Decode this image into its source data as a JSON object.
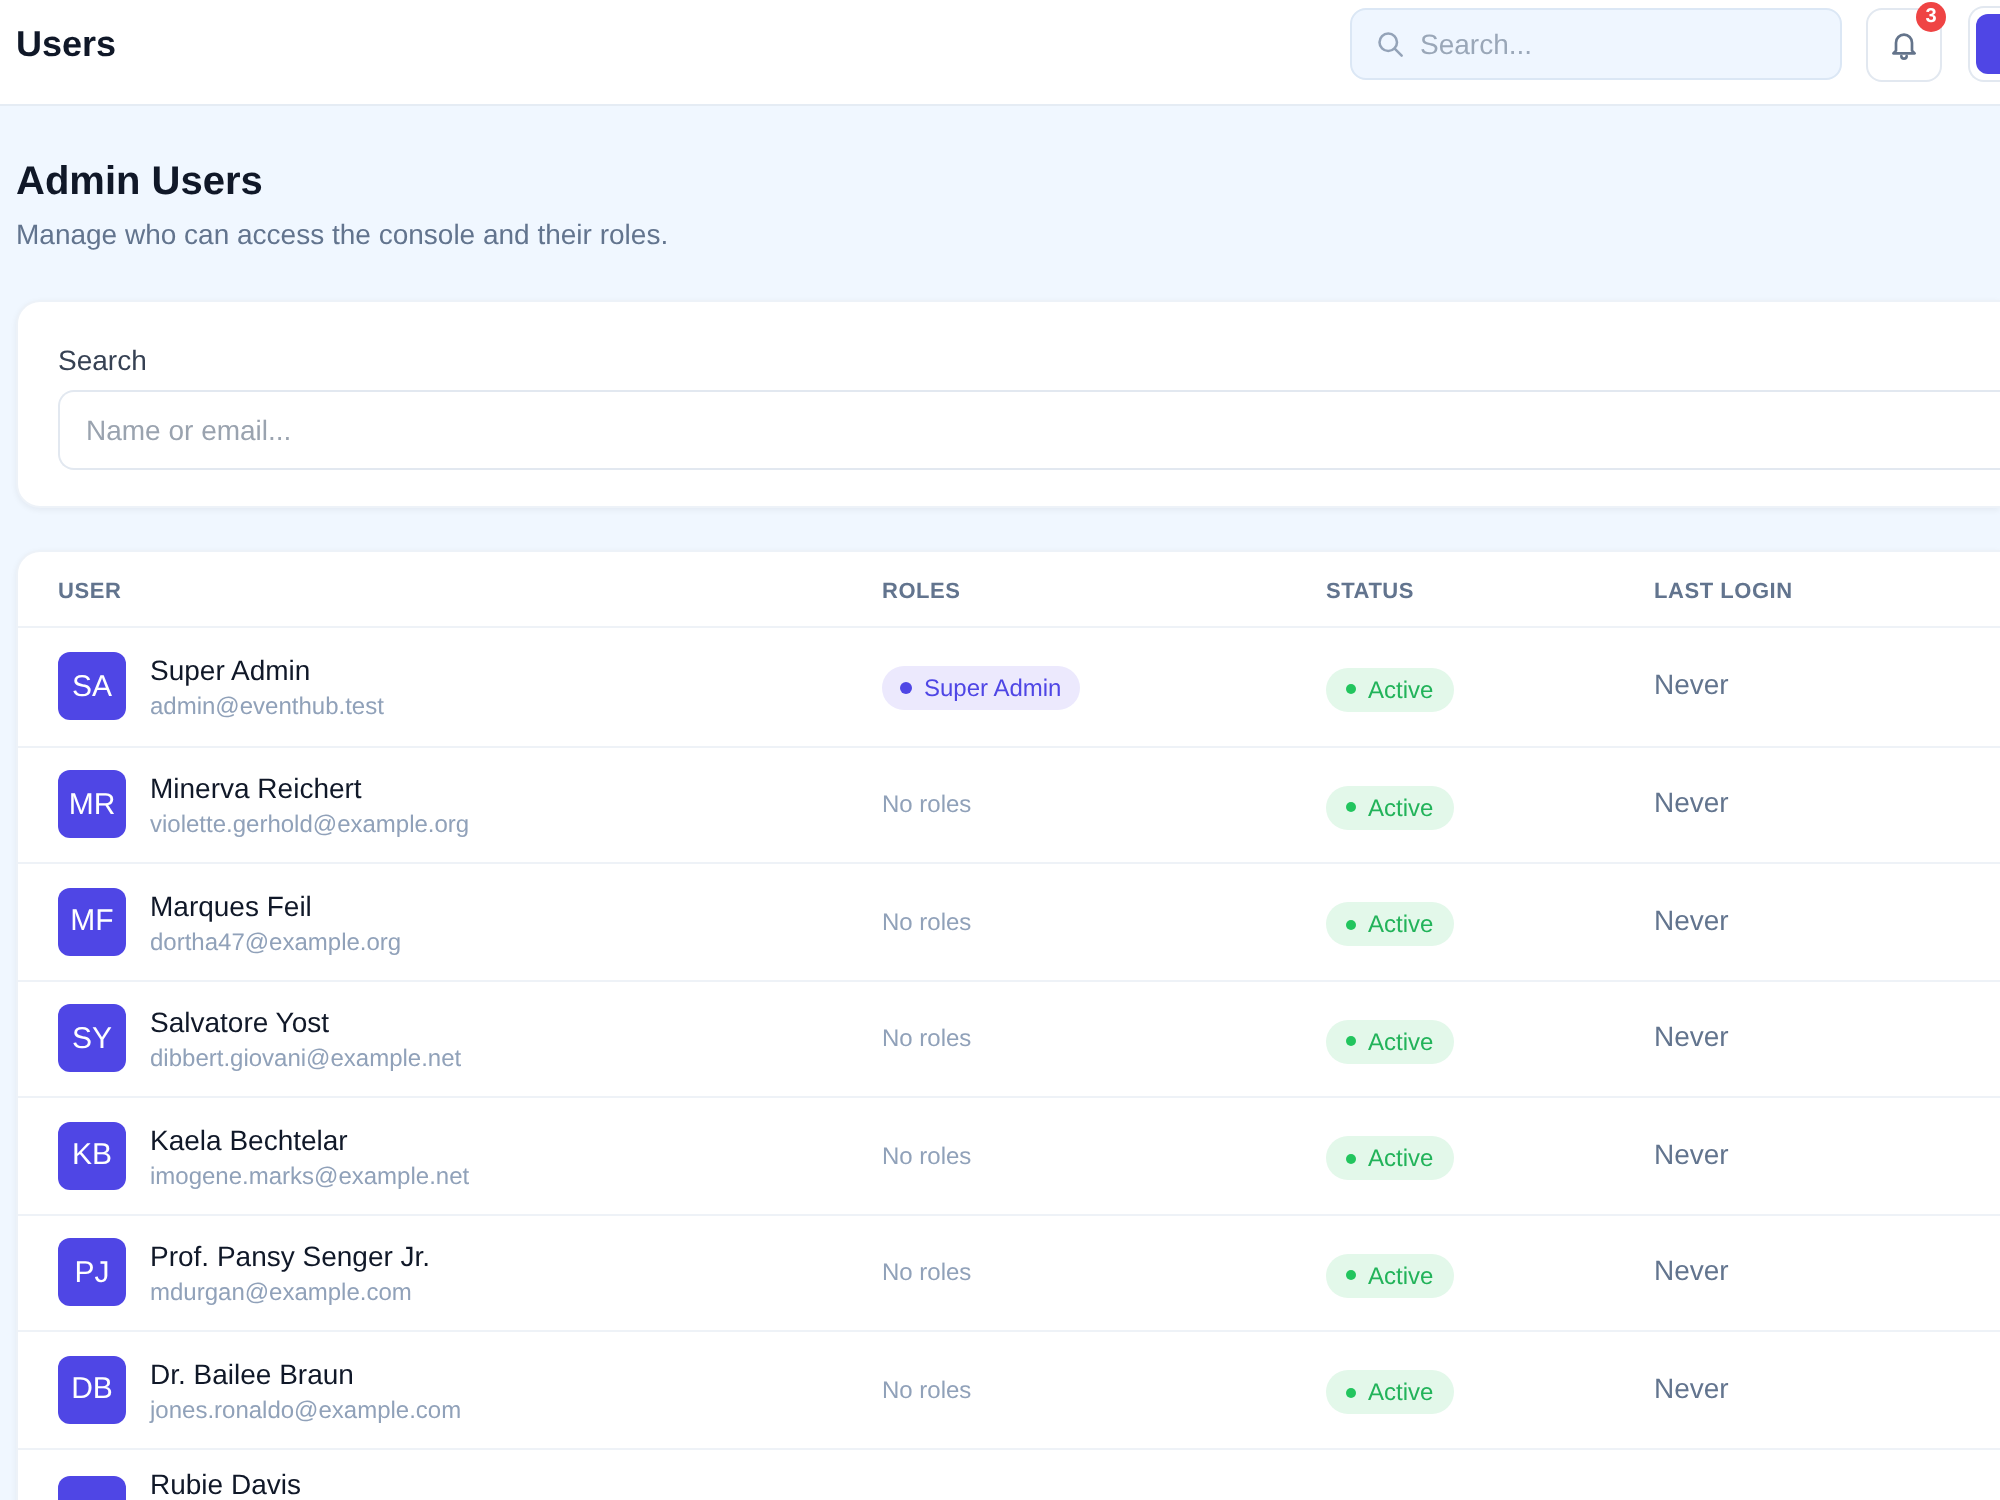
{
  "header": {
    "title": "Users",
    "search": {
      "placeholder": "Search..."
    },
    "notifications": {
      "count": "3"
    }
  },
  "page": {
    "title": "Admin Users",
    "subtitle": "Manage who can access the console and their roles."
  },
  "filter": {
    "label": "Search",
    "placeholder": "Name or email..."
  },
  "table": {
    "columns": [
      "USER",
      "ROLES",
      "STATUS",
      "LAST LOGIN"
    ],
    "rows": [
      {
        "initials": "SA",
        "name": "Super Admin",
        "email": "admin@eventhub.test",
        "role": {
          "kind": "badge",
          "label": "Super Admin"
        },
        "status": "Active",
        "last_login": "Never"
      },
      {
        "initials": "MR",
        "name": "Minerva Reichert",
        "email": "violette.gerhold@example.org",
        "role": {
          "kind": "none",
          "label": "No roles"
        },
        "status": "Active",
        "last_login": "Never"
      },
      {
        "initials": "MF",
        "name": "Marques Feil",
        "email": "dortha47@example.org",
        "role": {
          "kind": "none",
          "label": "No roles"
        },
        "status": "Active",
        "last_login": "Never"
      },
      {
        "initials": "SY",
        "name": "Salvatore Yost",
        "email": "dibbert.giovani@example.net",
        "role": {
          "kind": "none",
          "label": "No roles"
        },
        "status": "Active",
        "last_login": "Never"
      },
      {
        "initials": "KB",
        "name": "Kaela Bechtelar",
        "email": "imogene.marks@example.net",
        "role": {
          "kind": "none",
          "label": "No roles"
        },
        "status": "Active",
        "last_login": "Never"
      },
      {
        "initials": "PJ",
        "name": "Prof. Pansy Senger Jr.",
        "email": "mdurgan@example.com",
        "role": {
          "kind": "none",
          "label": "No roles"
        },
        "status": "Active",
        "last_login": "Never"
      },
      {
        "initials": "DB",
        "name": "Dr. Bailee Braun",
        "email": "jones.ronaldo@example.com",
        "role": {
          "kind": "none",
          "label": "No roles"
        },
        "status": "Active",
        "last_login": "Never"
      },
      {
        "name": "Rubie Davis"
      }
    ]
  }
}
